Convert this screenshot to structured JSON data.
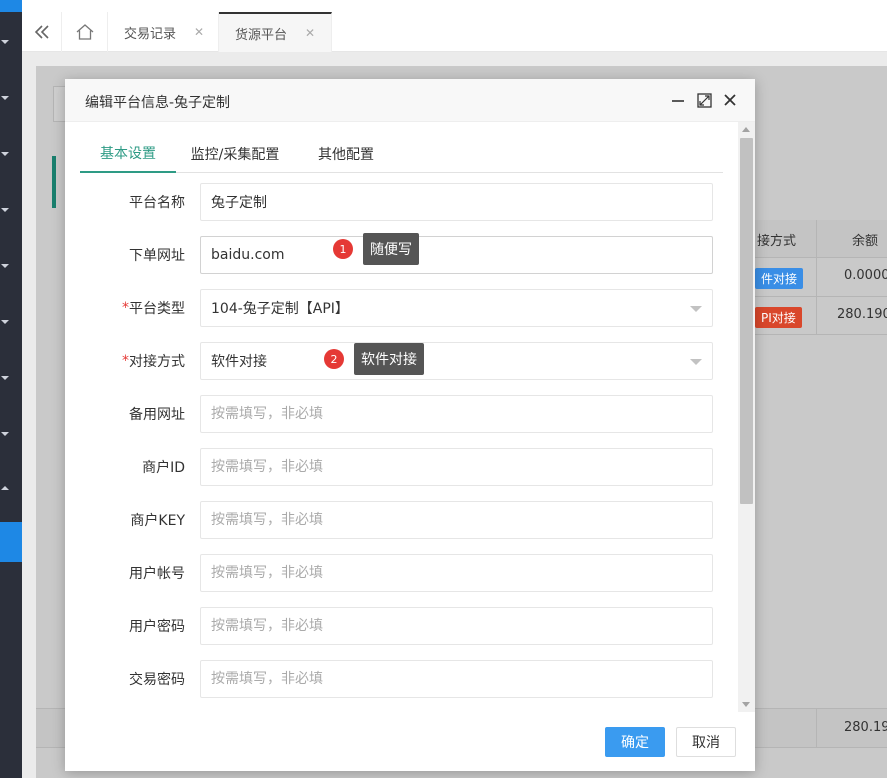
{
  "tabbar": {
    "tabs": [
      {
        "label": "交易记录"
      },
      {
        "label": "货源平台"
      }
    ]
  },
  "background": {
    "columns": [
      "接方式",
      "余额"
    ],
    "rows": [
      {
        "mode": "件对接",
        "balance": "0.0000"
      },
      {
        "mode": "PI对接",
        "balance": "280.190"
      }
    ],
    "footer_balance": "280.19"
  },
  "modal": {
    "title": "编辑平台信息-兔子定制",
    "tabs": [
      "基本设置",
      "监控/采集配置",
      "其他配置"
    ],
    "fields": [
      {
        "label": "平台名称",
        "value": "兔子定制"
      },
      {
        "label": "下单网址",
        "value": "baidu.com"
      },
      {
        "label": "平台类型",
        "value": "104-兔子定制【API】"
      },
      {
        "label": "对接方式",
        "value": "软件对接"
      },
      {
        "label": "备用网址",
        "placeholder": "按需填写，非必填"
      },
      {
        "label": "商户ID",
        "placeholder": "按需填写，非必填"
      },
      {
        "label": "商户KEY",
        "placeholder": "按需填写，非必填"
      },
      {
        "label": "用户帐号",
        "placeholder": "按需填写，非必填"
      },
      {
        "label": "用户密码",
        "placeholder": "按需填写，非必填"
      },
      {
        "label": "交易密码",
        "placeholder": "按需填写，非必填"
      }
    ],
    "required_mark": "*",
    "annotations": [
      {
        "num": "1",
        "text": "随便写"
      },
      {
        "num": "2",
        "text": "软件对接"
      }
    ],
    "confirm_label": "确定",
    "cancel_label": "取消"
  },
  "colors": {
    "accent_tab": "#2e9b85",
    "primary_button": "#3a9bf0",
    "annotation_dot": "#e53935",
    "badge_blue": "#3a8ee6",
    "badge_red": "#d9472b"
  },
  "icons": {
    "collapse": "double-chevron-left-icon",
    "home": "home-icon",
    "minimize": "minimize-icon",
    "maximize": "maximize-icon",
    "close": "close-icon"
  }
}
